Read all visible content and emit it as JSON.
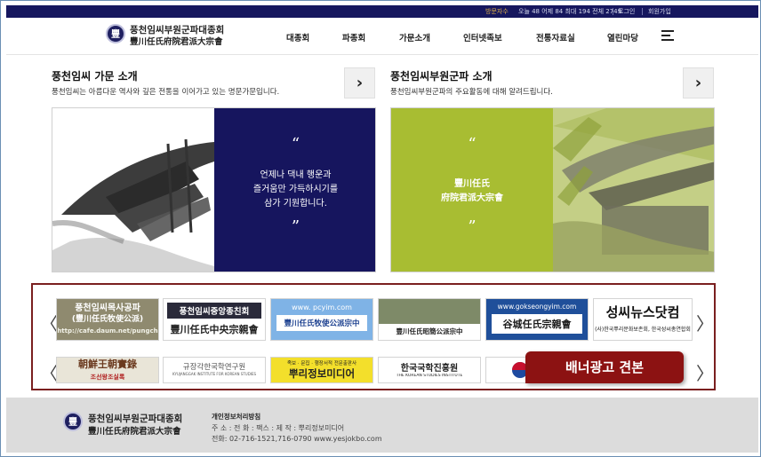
{
  "topbar": {
    "visitors_label": "방문자수",
    "visitors_counts": "오늘 48 어제 84 최대 194 전체 2749",
    "login": "로그인",
    "signup": "회원가입"
  },
  "header": {
    "logo_glyph": "豐",
    "logo_ko": "풍천임씨부원군파대종회",
    "logo_hanja": "豐川任氏府院君派大宗會",
    "nav": [
      "대종회",
      "파종회",
      "가문소개",
      "인터넷족보",
      "전통자료실",
      "열린마당"
    ]
  },
  "sections": [
    {
      "title": "풍천임씨 가문 소개",
      "desc": "풍천임씨는 아름다운 역사와 깊은 전통을 이어가고 있는 명문가문입니다.",
      "arrow": "›",
      "quote_open": "“",
      "quote_lines": [
        "언제나 댁내 행운과",
        "즐거움만 가득하시기를",
        "삼가 기원합니다."
      ],
      "quote_close": "”"
    },
    {
      "title": "풍천임씨부원군파 소개",
      "desc": "풍천임씨부원군파의 주요활동에 대해 알려드립니다.",
      "arrow": "›",
      "quote_open": "“",
      "quote_lines": [
        "豐川任氏",
        "府院君派大宗會"
      ],
      "quote_close": "”"
    }
  ],
  "banners": {
    "prev": "〈",
    "next": "〉",
    "row1": [
      {
        "line1": "풍천임씨목사공파",
        "line2": "(豐川任氏牧使公派)",
        "line3": "http://cafe.daum.net/pungch"
      },
      {
        "line1": "풍천임씨중앙종친회",
        "line2": "豐川任氏中央宗親會"
      },
      {
        "line1": "www. pcyim.com",
        "line2": "豐川任氏牧使公派宗中"
      },
      {
        "line1": "豐川任氏昭簡公派宗中"
      },
      {
        "line1": "www.gokseongyim.com",
        "line2": "谷城任氏宗親會"
      },
      {
        "line1": "성씨뉴스닷컴",
        "line2": "(사)한국뿌리문화보존회, 한국성씨총연합회"
      }
    ],
    "row2": [
      {
        "line1": "朝鮮王朝實錄",
        "line2": "조선왕조실록"
      },
      {
        "line1": "규장각한국학연구원",
        "line2": "KYUJANGGAK INSTITUTE FOR KOREAN STUDIES"
      },
      {
        "line1": "족보 · 문집 · 행장서적 전문출판사",
        "line2": "뿌리정보미디어"
      },
      {
        "line1": "한국국학진흥원",
        "line2": "THE KOREAN STUDIES INSTITUTE"
      }
    ],
    "ad_badge": "배너광고 견본"
  },
  "footer": {
    "logo_glyph": "豐",
    "logo_ko": "풍천임씨부원군파대종회",
    "logo_hanja": "豐川任氏府院君派大宗會",
    "policy": "개인정보처리방침",
    "line1": "주 소 :   전 화 :   팩스 :   제 작 : 뿌리정보미디어",
    "line2": "전화: 02-716-1521,716-0790   www.yesjokbo.com"
  },
  "colors": {
    "navy": "#16175e",
    "quote_panel": "#16155e",
    "green_panel": "#a8bd32",
    "ad_red": "#8c1212",
    "frame_border": "#7a1f1f"
  }
}
